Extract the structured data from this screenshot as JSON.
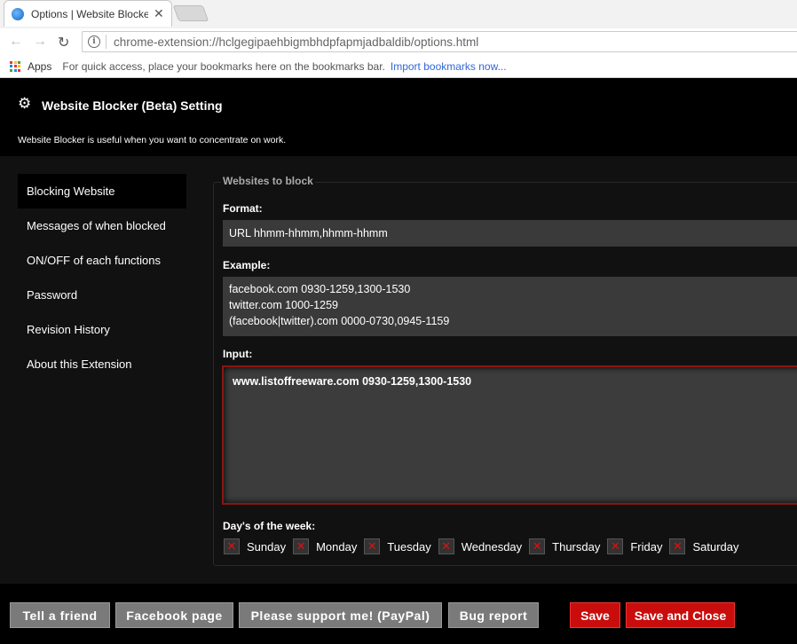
{
  "browser": {
    "tab_title": "Options | Website Blocker (Beta)",
    "tab_close": "✕",
    "url": "chrome-extension://hclgegipaehbigmbhdpfapmjadbaldib/options.html",
    "bookmarks": {
      "apps_label": "Apps",
      "hint": "For quick access, place your bookmarks here on the bookmarks bar.",
      "import_link": "Import bookmarks now..."
    }
  },
  "header": {
    "title": "Website Blocker (Beta) Setting",
    "subtitle": "Website Blocker is useful when you want to concentrate on work."
  },
  "sidebar": {
    "items": [
      {
        "label": "Blocking Website",
        "active": true
      },
      {
        "label": "Messages of when blocked",
        "active": false
      },
      {
        "label": "ON/OFF of each functions",
        "active": false
      },
      {
        "label": "Password",
        "active": false
      },
      {
        "label": "Revision History",
        "active": false
      },
      {
        "label": "About this Extension",
        "active": false
      }
    ]
  },
  "main": {
    "legend": "Websites to block",
    "format_label": "Format:",
    "format_value": "URL hhmm-hhmm,hhmm-hhmm",
    "example_label": "Example:",
    "example_lines": [
      "facebook.com 0930-1259,1300-1530",
      "twitter.com 1000-1259",
      "(facebook|twitter).com 0000-0730,0945-1159"
    ],
    "input_label": "Input:",
    "input_value": "www.listoffreeware.com 0930-1259,1300-1530",
    "days_label": "Day's of the week:",
    "days": [
      "Sunday",
      "Monday",
      "Tuesday",
      "Wednesday",
      "Thursday",
      "Friday",
      "Saturday"
    ]
  },
  "footer": {
    "tell_friend": "Tell a friend",
    "facebook_page": "Facebook page",
    "support": "Please support me! (PayPal)",
    "bug_report": "Bug report",
    "save": "Save",
    "save_close": "Save and Close"
  },
  "colors": {
    "accent_red": "#c90d0d",
    "button_gray": "#7a7a7a",
    "input_border": "#8a1515"
  }
}
